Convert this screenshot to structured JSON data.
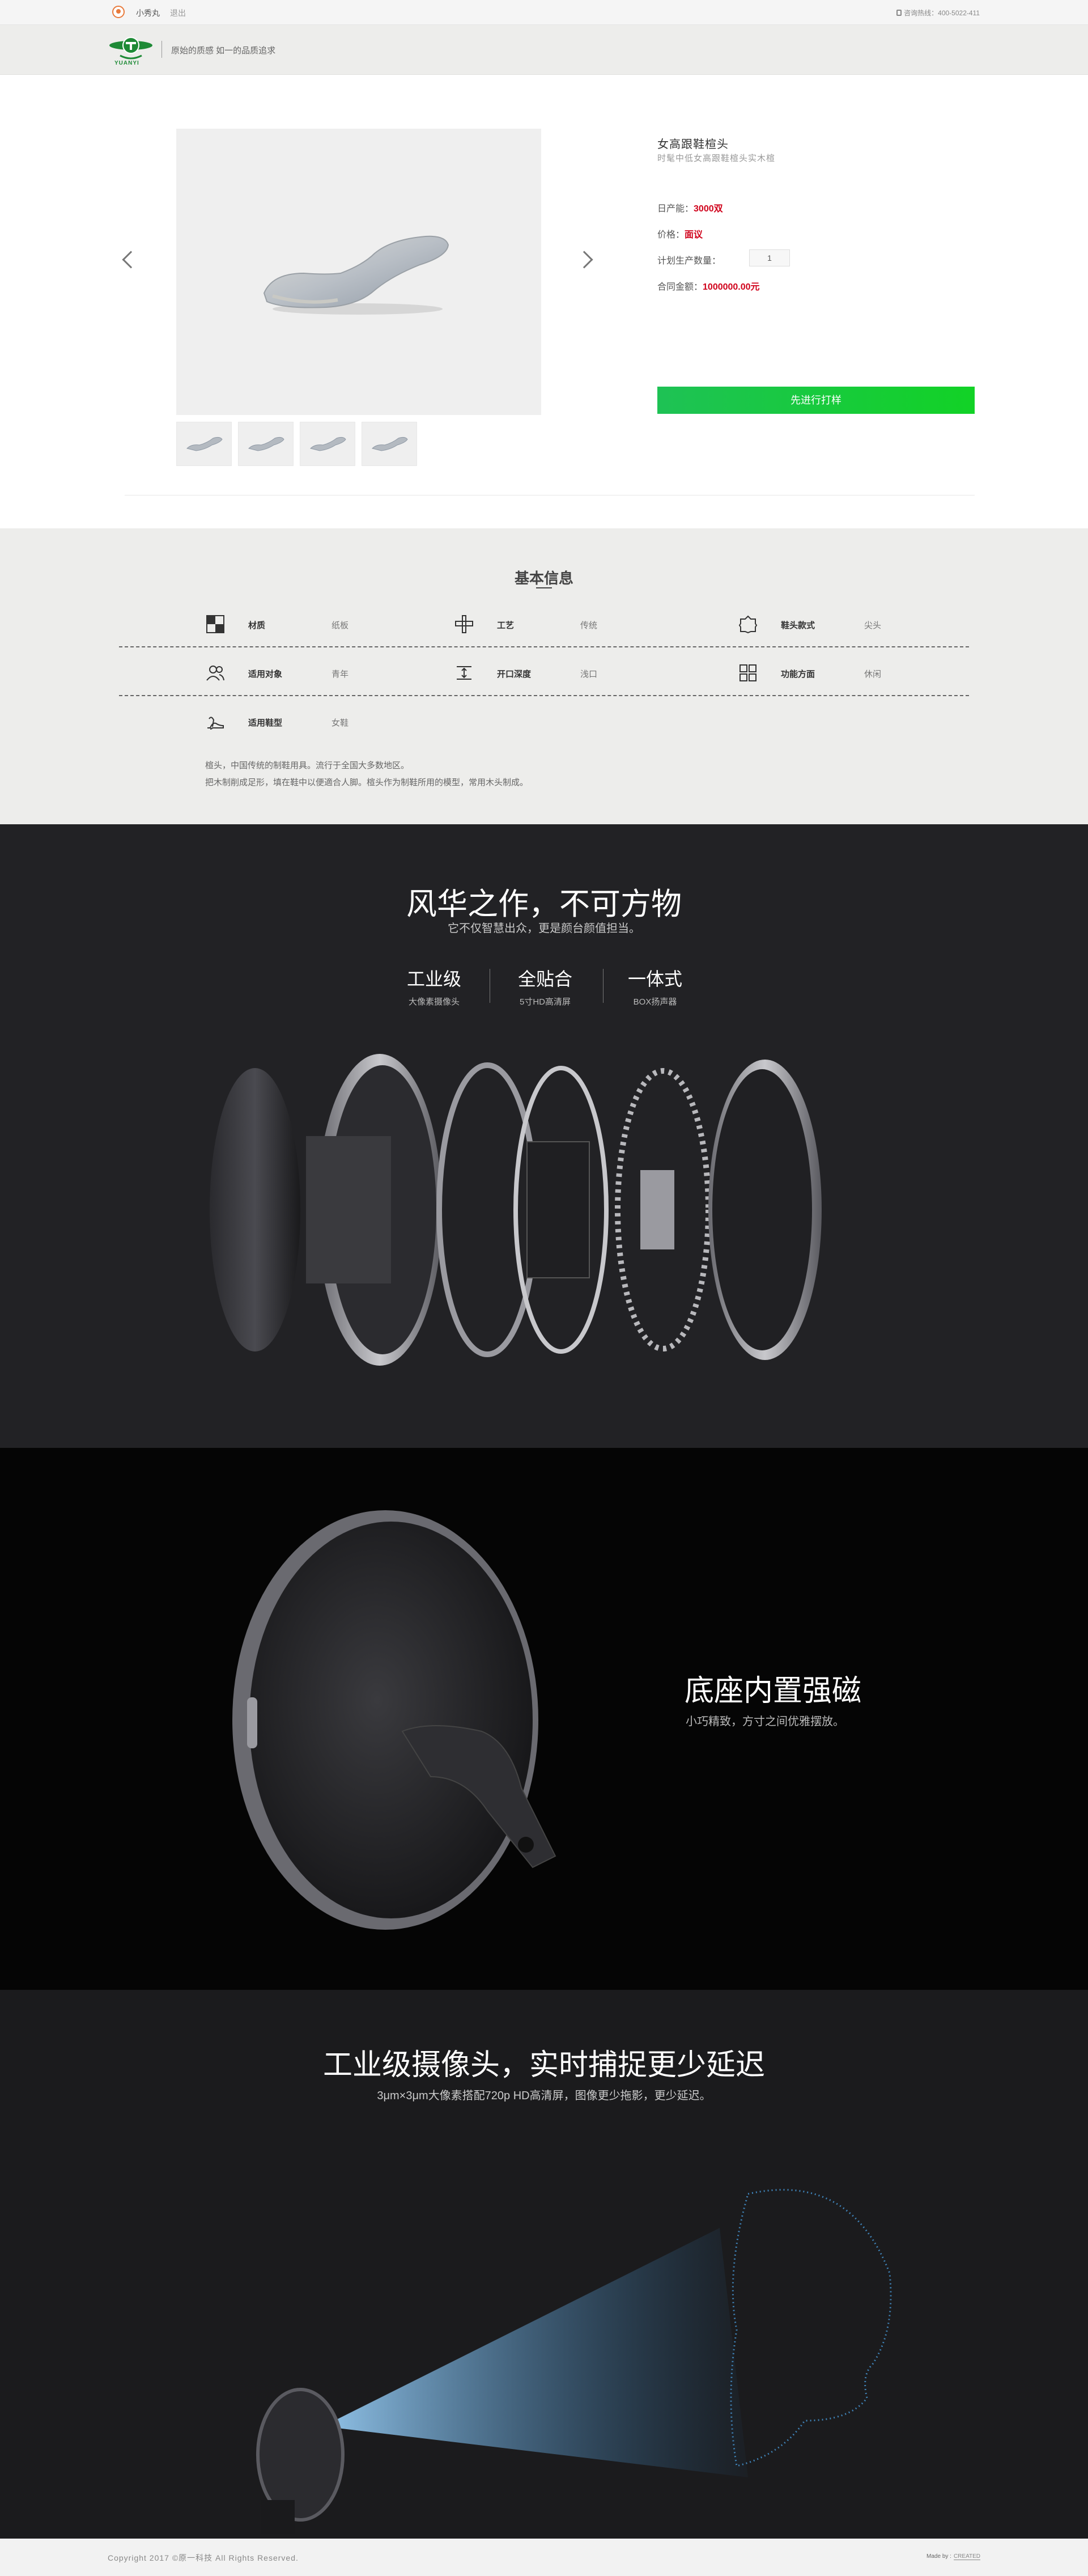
{
  "topbar": {
    "user_name": "小秀丸",
    "logout_label": "退出",
    "phone": "咨询热线：400-5022-411"
  },
  "header": {
    "logo_text": "YUANYI",
    "slogan": "原始的质感 如一的品质追求"
  },
  "product": {
    "title": "女高跟鞋楦头",
    "subtitle": "时髦中低女高跟鞋楦头实木楦",
    "daily_output_label": "日产能：",
    "daily_output_value": "3000双",
    "price_label": "价格：",
    "price_value": "面议",
    "plan_qty_label": "计划生产数量：",
    "plan_qty_value": "1",
    "contract_label": "合同金额：",
    "contract_value": "1000000.00元",
    "sample_button": "先进行打样",
    "thumbnail_count": 4
  },
  "basic_info": {
    "title": "基本信息",
    "rows": [
      [
        {
          "icon": "material-icon",
          "key": "材质",
          "value": "纸板"
        },
        {
          "icon": "craft-icon",
          "key": "工艺",
          "value": "传统"
        },
        {
          "icon": "toe-style-icon",
          "key": "鞋头款式",
          "value": "尖头"
        }
      ],
      [
        {
          "icon": "audience-icon",
          "key": "适用对象",
          "value": "青年"
        },
        {
          "icon": "depth-icon",
          "key": "开口深度",
          "value": "浅口"
        },
        {
          "icon": "function-icon",
          "key": "功能方面",
          "value": "休闲"
        }
      ],
      [
        {
          "icon": "shoe-type-icon",
          "key": "适用鞋型",
          "value": "女鞋"
        }
      ]
    ],
    "description_line1": "楦头，中国传统的制鞋用具。流行于全国大多数地区。",
    "description_line2": "把木制削成足形，填在鞋中以便適合人脚。楦头作为制鞋所用的模型，常用木头制成。"
  },
  "section_one": {
    "title": "风华之作，不可方物",
    "subtitle": "它不仅智慧出众，更是颜台颜值担当。",
    "features": [
      {
        "title": "工业级",
        "subtitle": "大像素摄像头"
      },
      {
        "title": "全贴合",
        "subtitle": "5寸HD高清屏"
      },
      {
        "title": "一体式",
        "subtitle": "BOX扬声器"
      }
    ]
  },
  "section_two": {
    "title": "底座内置强磁",
    "subtitle": "小巧精致，方寸之间优雅摆放。"
  },
  "section_three": {
    "title": "工业级摄像头，实时捕捉更少延迟",
    "subtitle": "3μm×3μm大像素搭配720p HD高清屏，图像更少拖影，更少延迟。"
  },
  "footer": {
    "copyright": "Copyright 2017 ©原一科技 All Rights Reserved.",
    "made_by_label": "Made by :",
    "made_by_name": "CREATED"
  },
  "colors": {
    "accent_red": "#d0021b",
    "button_green": "#12d226",
    "logo_green": "#1e8a36"
  }
}
